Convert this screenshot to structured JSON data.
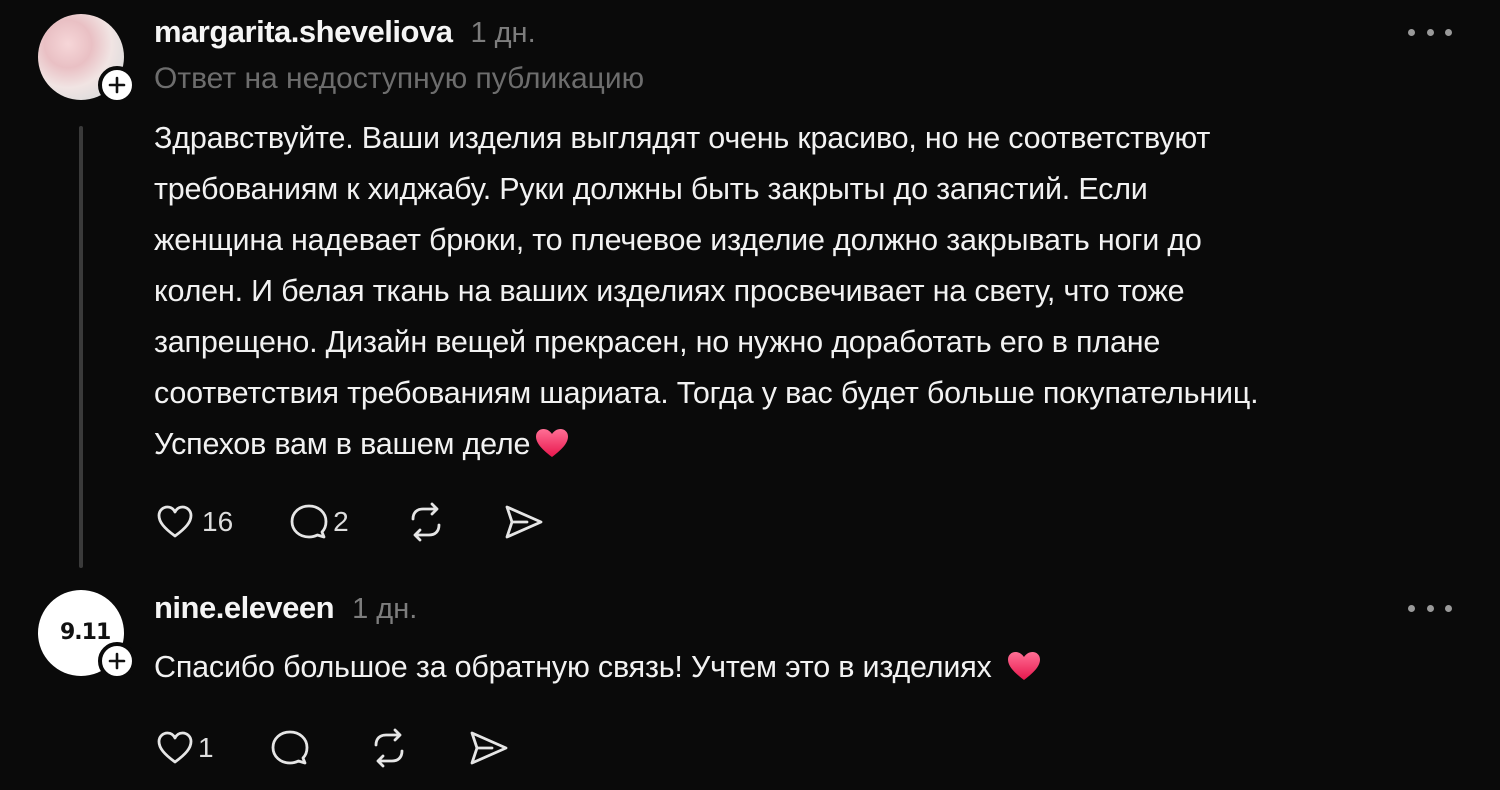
{
  "comments": [
    {
      "username": "margarita.sheveliova",
      "time": "1 дн.",
      "reply_note": "Ответ на недоступную публикацию",
      "lines": [
        "Здравствуйте. Ваши изделия выглядят очень красиво, но не соответствуют",
        "требованиям к хиджабу. Руки должны быть закрыты до запястий. Если",
        "женщина надевает брюки, то плечевое изделие должно закрывать ноги до",
        "колен. И белая ткань на ваших изделиях просвечивает на свету, что тоже",
        "запрещено. Дизайн вещей прекрасен, но нужно доработать его в плане",
        "соответствия требованиям шариата. Тогда у вас будет больше покупательниц.",
        "Успехов вам в вашем деле"
      ],
      "likes": "16",
      "replies": "2",
      "heart_emoji": "heart-emoji"
    },
    {
      "username": "nine.eleveen",
      "time": "1 дн.",
      "avatar_text": "9.11",
      "text": "Спасибо большое за обратную связь! Учтем это в изделиях",
      "likes": "1",
      "heart_emoji": "heart-emoji"
    }
  ],
  "colors": {
    "background": "#0a0a0a",
    "text": "#f2f2f2",
    "muted": "#7d7d7d",
    "heart": "#ff3b6b"
  },
  "icons": [
    "like-icon",
    "comment-icon",
    "repost-icon",
    "share-icon",
    "more-icon",
    "follow-plus-icon"
  ]
}
